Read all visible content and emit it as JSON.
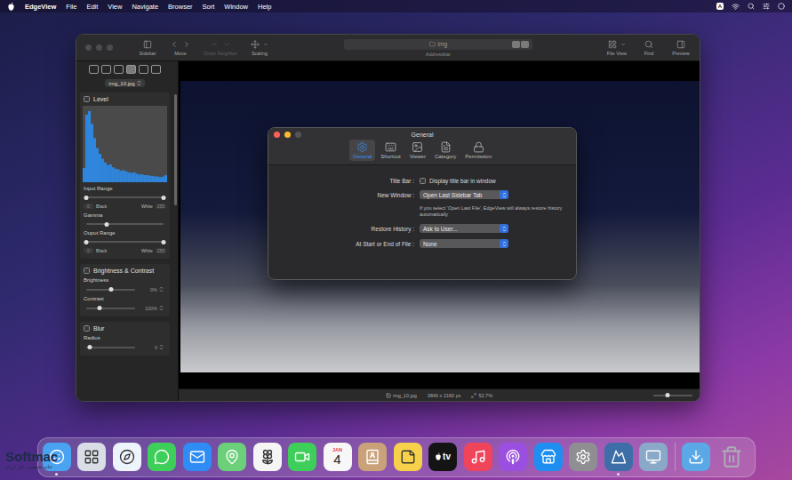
{
  "menu_bar": {
    "app": "EdgeView",
    "items": [
      "File",
      "Edit",
      "View",
      "Navigate",
      "Browser",
      "Sort",
      "Window",
      "Help"
    ],
    "input_source": "A"
  },
  "window": {
    "toolbar": {
      "left": [
        {
          "kind": "sidebar",
          "label": "Sidebar",
          "disabled": false
        },
        {
          "kind": "move",
          "label": "Move",
          "disabled": false
        },
        {
          "kind": "order",
          "label": "Order Neighbor",
          "disabled": true
        },
        {
          "kind": "scaling",
          "label": "Scaling",
          "disabled": false
        }
      ],
      "address": {
        "text": "img",
        "label": "Addressbar"
      },
      "right": [
        {
          "kind": "fileview",
          "label": "File View",
          "disabled": false
        },
        {
          "kind": "find",
          "label": "Find",
          "disabled": false
        },
        {
          "kind": "preview",
          "label": "Preview",
          "disabled": false
        }
      ]
    },
    "sidebar": {
      "tabs": [
        {
          "selected": false
        },
        {
          "selected": false
        },
        {
          "selected": false
        },
        {
          "selected": true
        },
        {
          "selected": false
        },
        {
          "selected": false
        }
      ],
      "file": "img_10.jpg",
      "sections": [
        {
          "title": "Level",
          "checked": false,
          "rows": [
            {
              "kind": "histogram",
              "values": [
                20,
                95,
                100,
                82,
                62,
                48,
                40,
                33,
                28,
                24,
                25,
                21,
                19,
                18,
                16,
                17,
                15,
                14,
                13,
                14,
                12,
                11,
                11,
                10,
                10,
                9,
                9,
                8,
                8,
                7,
                8,
                10
              ]
            },
            {
              "kind": "label",
              "text": "Input Range"
            },
            {
              "kind": "range",
              "low": 0,
              "high": 1
            },
            {
              "kind": "ends",
              "low_value": "0",
              "low_label": "Black",
              "high_label": "White",
              "high_value": "255"
            },
            {
              "kind": "label",
              "text": "Gamma"
            },
            {
              "kind": "slider",
              "level": 0.27
            },
            {
              "kind": "label",
              "text": "Ouput Range"
            },
            {
              "kind": "range",
              "low": 0,
              "high": 1
            },
            {
              "kind": "ends",
              "low_value": "0",
              "low_label": "Black",
              "high_label": "White",
              "high_value": "255"
            }
          ]
        },
        {
          "title": "Brightness & Contrast",
          "checked": false,
          "rows": [
            {
              "kind": "label",
              "text": "Brightness"
            },
            {
              "kind": "slider",
              "level": 0.5,
              "value": "0%"
            },
            {
              "kind": "label",
              "text": "Contrast"
            },
            {
              "kind": "slider",
              "level": 0.27,
              "value": "100%"
            }
          ]
        },
        {
          "title": "Blur",
          "checked": false,
          "rows": [
            {
              "kind": "label",
              "text": "Radius"
            },
            {
              "kind": "slider",
              "level": 0.08,
              "value": "0"
            }
          ]
        }
      ]
    },
    "status_bar": {
      "file": "img_10.jpg",
      "size": "3840 x 2160 px",
      "zoom": "52.7%",
      "zoom_level": 0.36
    }
  },
  "dialog": {
    "title": "General",
    "tabs": [
      {
        "kind": "general",
        "label": "General",
        "selected": true
      },
      {
        "kind": "shortcut",
        "label": "Shortcut",
        "selected": false
      },
      {
        "kind": "viewer",
        "label": "Viewer",
        "selected": false
      },
      {
        "kind": "category",
        "label": "Category",
        "selected": false
      },
      {
        "kind": "permission",
        "label": "Permission",
        "selected": false
      }
    ],
    "rows": [
      {
        "kind": "checkbox",
        "label": "Title Bar :",
        "text": "Display title bar in window",
        "checked": false
      },
      {
        "kind": "select",
        "label": "New Window :",
        "value": "Open Last Sidebar Tab",
        "note": "If you select 'Open Last File', EdgeView will always restore history automatically"
      },
      {
        "kind": "select",
        "label": "Restore History :",
        "value": "Ask to User..."
      },
      {
        "kind": "select",
        "label": "At Start or End of File :",
        "value": "None"
      }
    ]
  },
  "dock": {
    "apps": [
      {
        "kind": "finder",
        "color": "#4aa3f0",
        "running": true
      },
      {
        "kind": "launchpad",
        "color": "#d9dde6",
        "running": false
      },
      {
        "kind": "safari",
        "color": "#eef4fb",
        "running": false
      },
      {
        "kind": "messages",
        "color": "#3ecf5a",
        "running": false
      },
      {
        "kind": "mail",
        "color": "#2f8cf5",
        "running": false
      },
      {
        "kind": "maps",
        "color": "#6ccf7a",
        "running": false
      },
      {
        "kind": "photos",
        "color": "#f5f5f5",
        "running": false
      },
      {
        "kind": "facetime",
        "color": "#3ecf5a",
        "running": false
      },
      {
        "kind": "calendar",
        "color": "#f7f7f7",
        "month": "JAN",
        "day": "4",
        "running": false
      },
      {
        "kind": "contacts",
        "color": "#c9a27a",
        "running": false
      },
      {
        "kind": "notes",
        "color": "#f7d14a",
        "running": false
      },
      {
        "kind": "tv",
        "color": "#141414",
        "label": "tv",
        "running": false
      },
      {
        "kind": "music",
        "color": "#f0445a",
        "running": false
      },
      {
        "kind": "podcasts",
        "color": "#9b4fe0",
        "running": false
      },
      {
        "kind": "appstore",
        "color": "#1e8ff0",
        "running": false
      },
      {
        "kind": "settings",
        "color": "#8e8e93",
        "running": false
      },
      {
        "kind": "edgeview",
        "color": "#3d6ea8",
        "running": true
      },
      {
        "kind": "monitor",
        "color": "#8aa8c8",
        "running": false
      }
    ],
    "stacks": [
      {
        "kind": "downloads",
        "color": "#5aa9e6"
      },
      {
        "kind": "trash",
        "color": "#aab0b6"
      }
    ]
  },
  "watermark": {
    "brand": "Softmac",
    "subtitle": "خانه تخصصی اپل ایران"
  }
}
